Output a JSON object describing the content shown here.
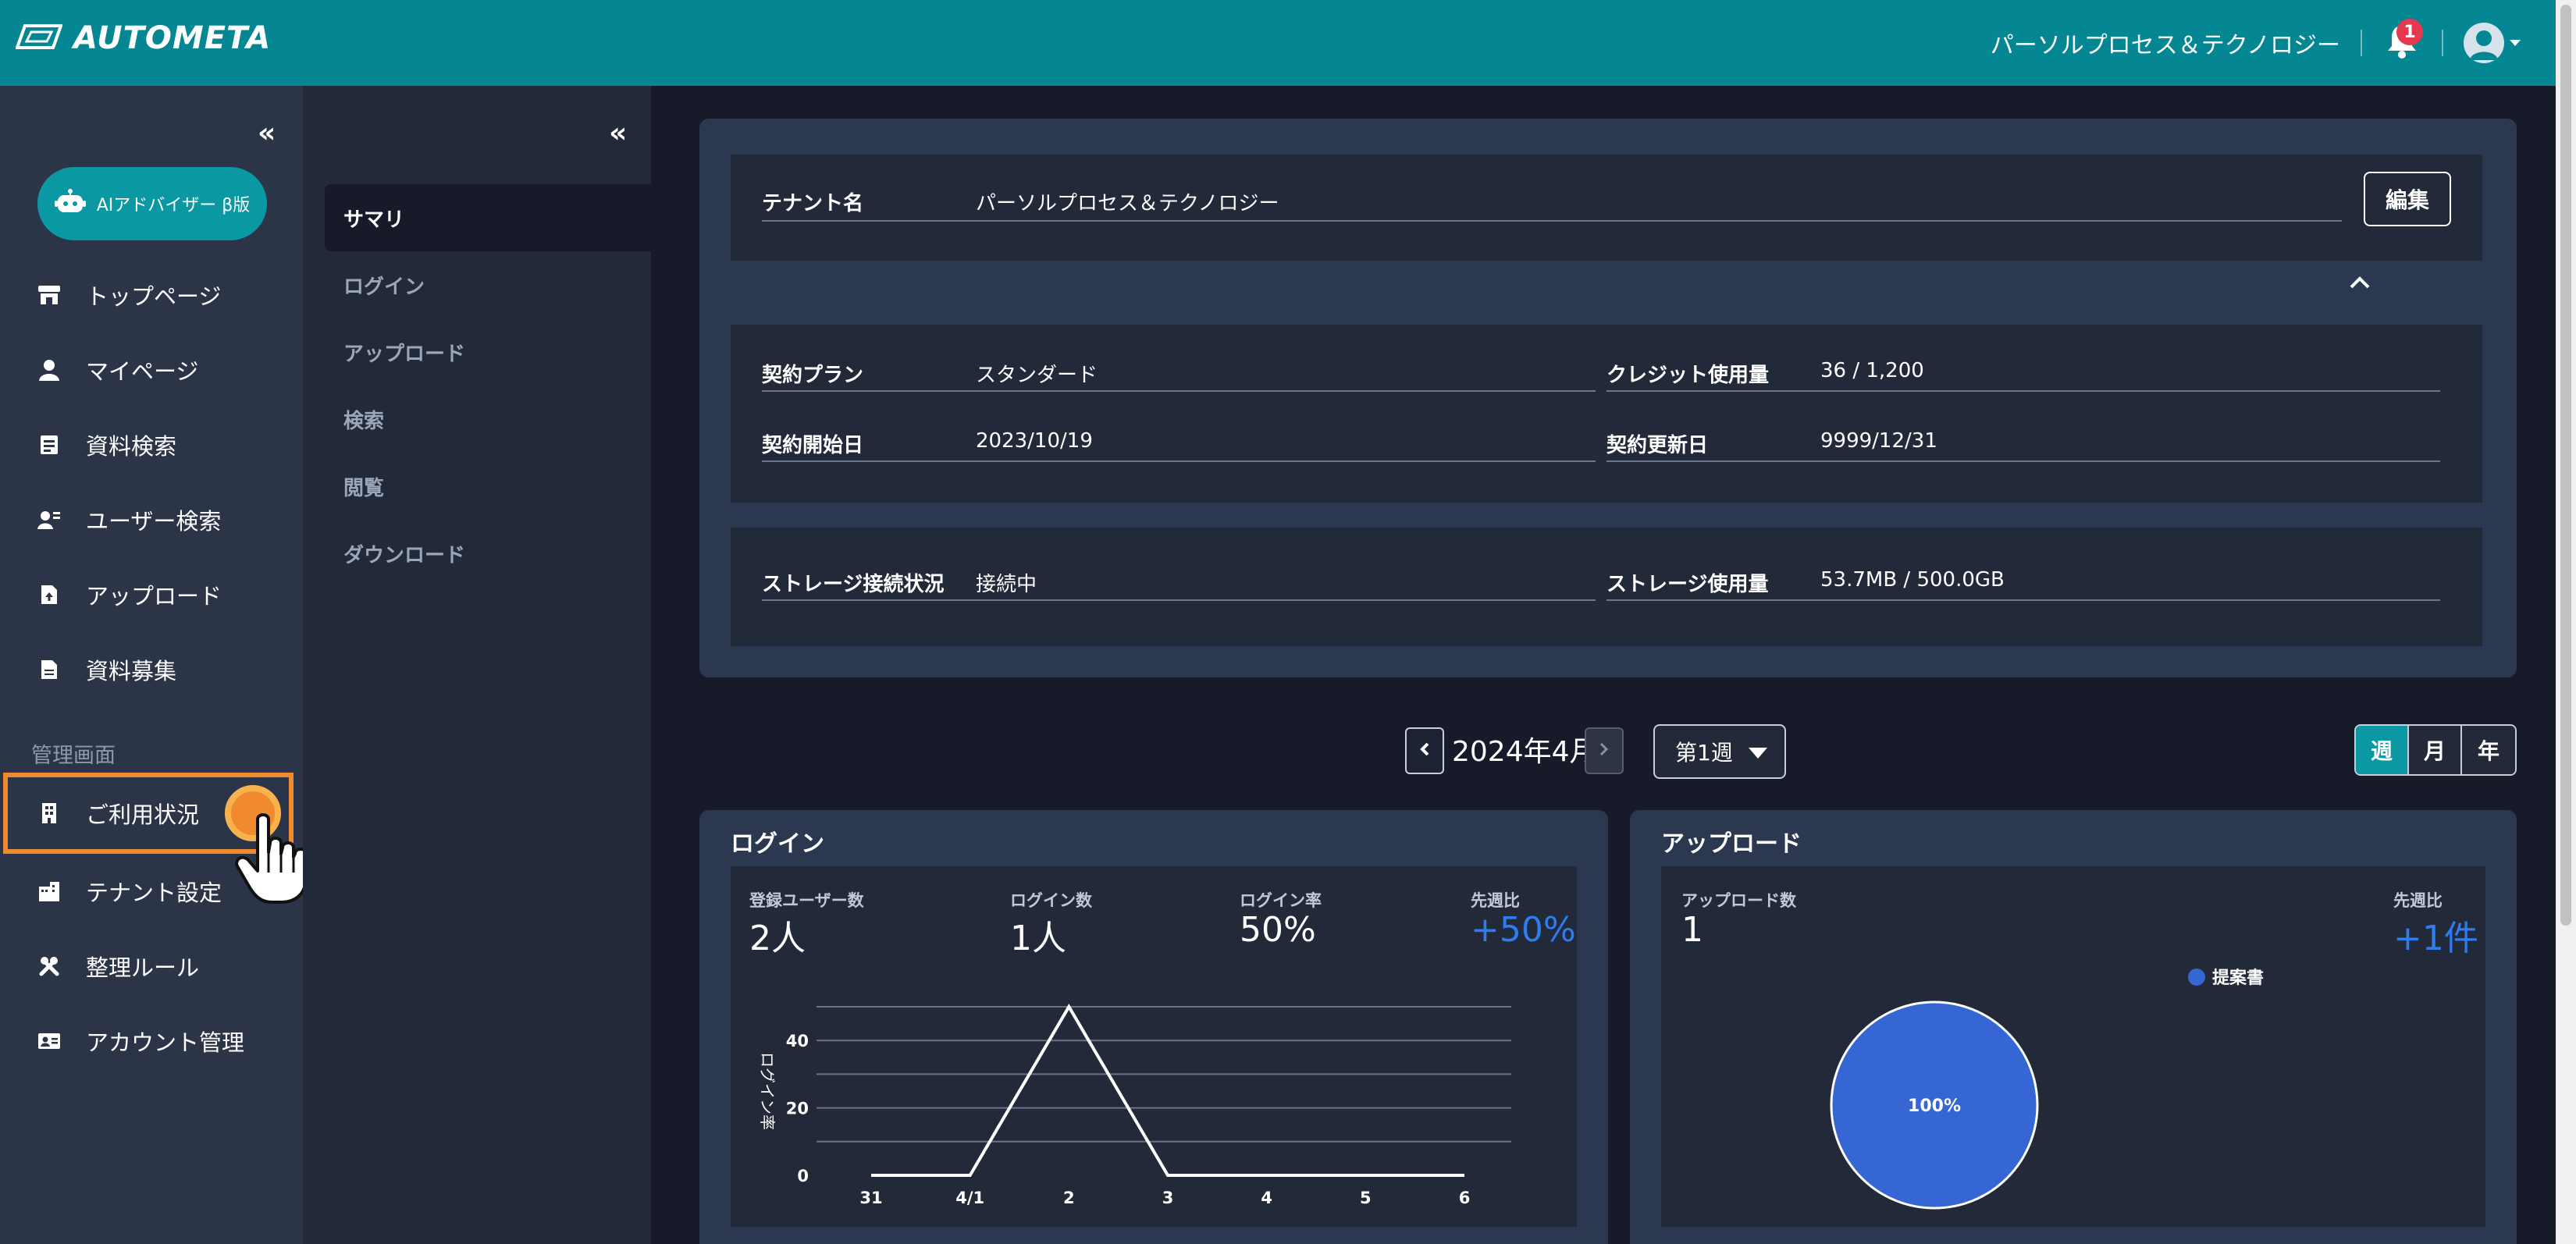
{
  "header": {
    "brand": "AUTOMETA",
    "tenant_name": "パーソルプロセス＆テクノロジー",
    "notification_count": "1",
    "colors": {
      "bar": "#048793",
      "badge": "#e53950"
    }
  },
  "sidebar": {
    "collapse_glyph": "«",
    "ai_button_label": "AIアドバイザー β版",
    "items": [
      {
        "label": "トップページ",
        "icon": "store-icon"
      },
      {
        "label": "マイページ",
        "icon": "person-icon"
      },
      {
        "label": "資料検索",
        "icon": "document-search-icon"
      },
      {
        "label": "ユーザー検索",
        "icon": "user-search-icon"
      },
      {
        "label": "アップロード",
        "icon": "file-upload-icon"
      },
      {
        "label": "資料募集",
        "icon": "file-icon"
      }
    ],
    "admin_section_label": "管理画面",
    "admin_items": [
      {
        "label": "ご利用状況",
        "icon": "building-icon"
      },
      {
        "label": "テナント設定",
        "icon": "tenant-icon"
      },
      {
        "label": "整理ルール",
        "icon": "tools-icon"
      },
      {
        "label": "アカウント管理",
        "icon": "id-card-icon"
      }
    ]
  },
  "sub_sidebar": {
    "collapse_glyph": "«",
    "items": [
      {
        "label": "サマリ"
      },
      {
        "label": "ログイン"
      },
      {
        "label": "アップロード"
      },
      {
        "label": "検索"
      },
      {
        "label": "閲覧"
      },
      {
        "label": "ダウンロード"
      }
    ]
  },
  "tenant_panel": {
    "tenant_label": "テナント名",
    "tenant_value": "パーソルプロセス＆テクノロジー",
    "edit_label": "編集",
    "plan_label": "契約プラン",
    "plan_value": "スタンダード",
    "credit_label": "クレジット使用量",
    "credit_value": "36 / 1,200",
    "start_label": "契約開始日",
    "start_value": "2023/10/19",
    "renew_label": "契約更新日",
    "renew_value": "9999/12/31",
    "storage_status_label": "ストレージ接続状況",
    "storage_status_value": "接続中",
    "storage_usage_label": "ストレージ使用量",
    "storage_usage_value": "53.7MB / 500.0GB"
  },
  "period": {
    "label": "2024年4月",
    "week": "第1週",
    "tabs": [
      {
        "label": "週",
        "active": true
      },
      {
        "label": "月",
        "active": false
      },
      {
        "label": "年",
        "active": false
      }
    ]
  },
  "login_card": {
    "title": "ログイン",
    "stats": [
      {
        "label": "登録ユーザー数",
        "value": "2人"
      },
      {
        "label": "ログイン数",
        "value": "1人"
      },
      {
        "label": "ログイン率",
        "value": "50%"
      },
      {
        "label": "先週比",
        "value": "+50%"
      }
    ]
  },
  "upload_card": {
    "title": "アップロード",
    "count_label": "アップロード数",
    "count_value": "1",
    "wow_label": "先週比",
    "wow_value": "+1件"
  },
  "chart_data": [
    {
      "type": "line",
      "ylabel": "ログイン率",
      "x": [
        "31",
        "4/1",
        "2",
        "3",
        "4",
        "5",
        "6"
      ],
      "yticks": [
        0,
        20,
        40
      ],
      "ylim": [
        0,
        50
      ],
      "grid": true,
      "series": [
        {
          "values": [
            0,
            0,
            50,
            0,
            0,
            0,
            0
          ]
        }
      ],
      "color": "#ffffff"
    },
    {
      "type": "pie",
      "labels": [
        "提案書"
      ],
      "values": [
        100
      ],
      "slice_labels": [
        "100%"
      ],
      "colors": [
        "#3566d4"
      ],
      "legend": "top-right"
    }
  ]
}
